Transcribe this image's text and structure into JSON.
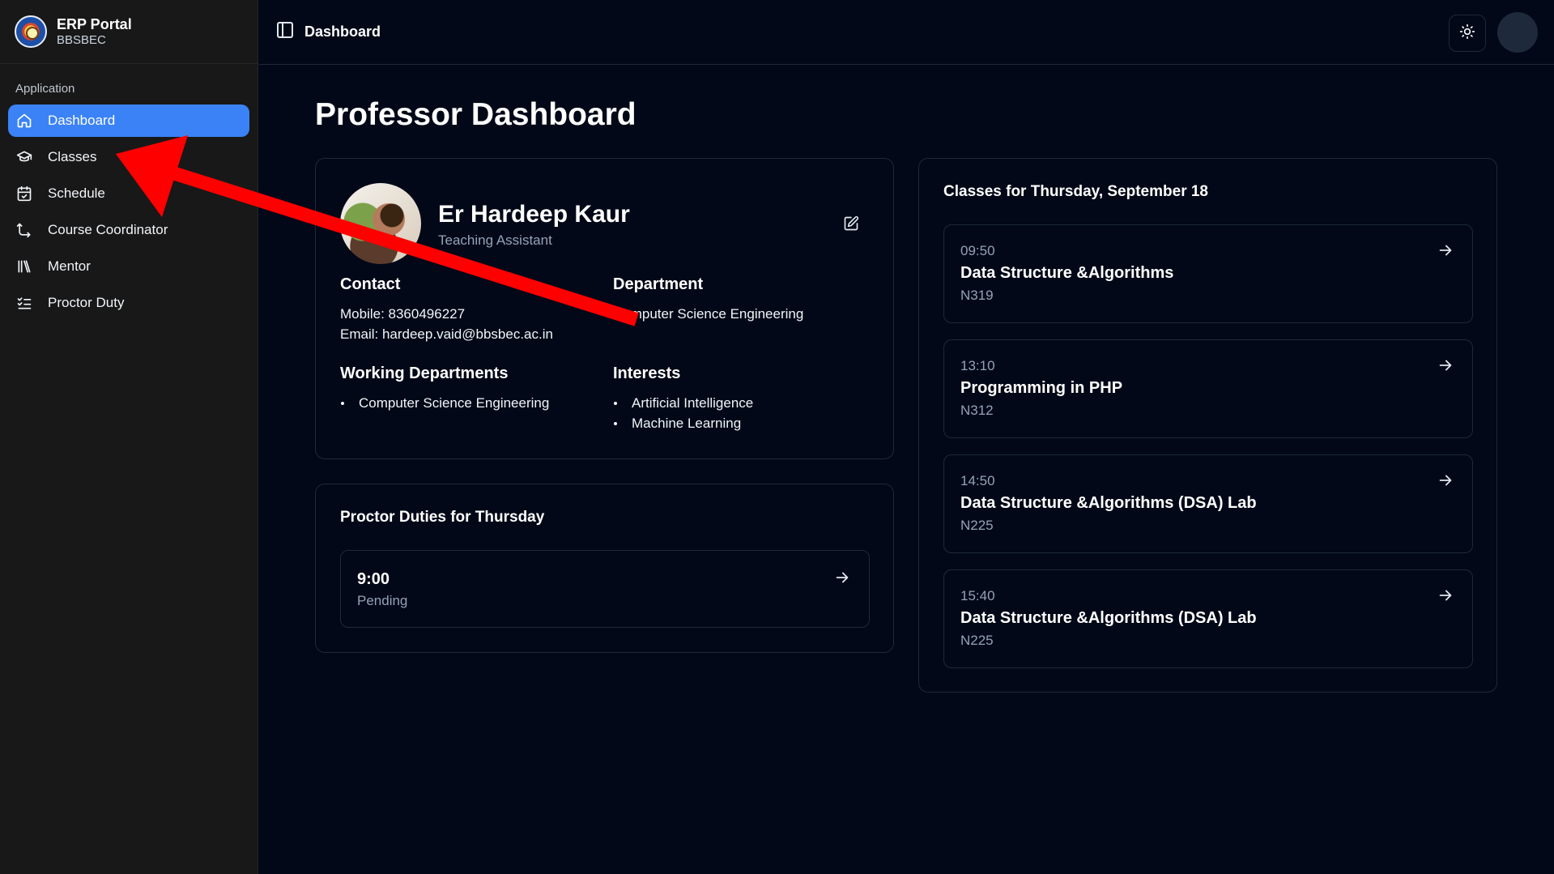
{
  "brand": {
    "title": "ERP Portal",
    "subtitle": "BBSBEC"
  },
  "sidebar": {
    "group_label": "Application",
    "items": [
      {
        "label": "Dashboard",
        "icon": "home-icon",
        "active": true
      },
      {
        "label": "Classes",
        "icon": "graduation-cap-icon",
        "active": false
      },
      {
        "label": "Schedule",
        "icon": "calendar-icon",
        "active": false
      },
      {
        "label": "Course Coordinator",
        "icon": "route-icon",
        "active": false
      },
      {
        "label": "Mentor",
        "icon": "library-icon",
        "active": false
      },
      {
        "label": "Proctor Duty",
        "icon": "list-checks-icon",
        "active": false
      }
    ]
  },
  "topbar": {
    "title": "Dashboard",
    "theme_icon": "sun-icon"
  },
  "page": {
    "title": "Professor Dashboard"
  },
  "profile": {
    "name": "Er Hardeep Kaur",
    "role": "Teaching Assistant",
    "contact_heading": "Contact",
    "mobile": "Mobile: 8360496227",
    "email": "Email: hardeep.vaid@bbsbec.ac.in",
    "department_heading": "Department",
    "department": "Computer Science Engineering",
    "working_heading": "Working Departments",
    "working_departments": [
      "Computer Science Engineering"
    ],
    "interests_heading": "Interests",
    "interests": [
      "Artificial Intelligence",
      "Machine Learning"
    ]
  },
  "proctor": {
    "title": "Proctor Duties for Thursday",
    "duties": [
      {
        "time": "9:00",
        "status": "Pending"
      }
    ]
  },
  "classes": {
    "title": "Classes for Thursday, September 18",
    "items": [
      {
        "time": "09:50",
        "name": "Data Structure &Algorithms",
        "room": "N319"
      },
      {
        "time": "13:10",
        "name": "Programming in PHP",
        "room": "N312"
      },
      {
        "time": "14:50",
        "name": "Data Structure &Algorithms (DSA) Lab",
        "room": "N225"
      },
      {
        "time": "15:40",
        "name": "Data Structure &Algorithms (DSA) Lab",
        "room": "N225"
      }
    ]
  },
  "colors": {
    "accent": "#3b82f6",
    "background": "#020817",
    "sidebar": "#181818",
    "annotation_arrow": "#ff0000"
  }
}
